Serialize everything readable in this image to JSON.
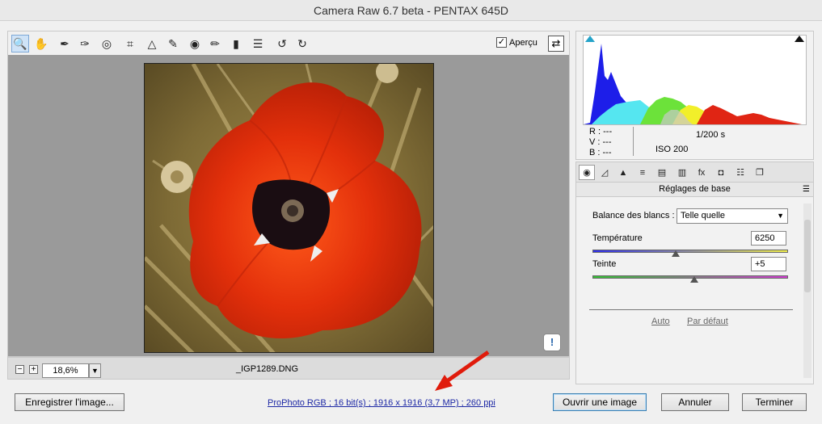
{
  "window": {
    "title": "Camera Raw 6.7 beta  -  PENTAX 645D"
  },
  "toolbar": {
    "tools": [
      {
        "name": "zoom-tool-icon",
        "glyph": "🔍"
      },
      {
        "name": "hand-tool-icon",
        "glyph": "✋"
      },
      {
        "name": "white-balance-tool-icon",
        "glyph": "✒"
      },
      {
        "name": "color-sampler-tool-icon",
        "glyph": "✑"
      },
      {
        "name": "target-adjustment-tool-icon",
        "glyph": "◎"
      },
      {
        "name": "crop-tool-icon",
        "glyph": "⌗"
      },
      {
        "name": "straighten-tool-icon",
        "glyph": "△"
      },
      {
        "name": "spot-removal-tool-icon",
        "glyph": "✎"
      },
      {
        "name": "red-eye-tool-icon",
        "glyph": "◉"
      },
      {
        "name": "adjustment-brush-icon",
        "glyph": "✏"
      },
      {
        "name": "graduated-filter-icon",
        "glyph": "▮"
      },
      {
        "name": "preferences-icon",
        "glyph": "☰"
      },
      {
        "name": "rotate-left-icon",
        "glyph": "↺"
      },
      {
        "name": "rotate-right-icon",
        "glyph": "↻"
      }
    ],
    "preview_label": "Aperçu",
    "preview_checked": "✓",
    "fullscreen_glyph": "⇄"
  },
  "status": {
    "zoom_value": "18,6%",
    "zoom_out": "−",
    "zoom_in": "+",
    "filename": "_IGP1289.DNG"
  },
  "info_panel": {
    "r_label": "R :  ---",
    "v_label": "V :  ---",
    "b_label": "B :  ---",
    "shutter": "1/200 s",
    "iso": "ISO 200"
  },
  "panel": {
    "title": "Réglages de base",
    "white_balance_label": "Balance des blancs :",
    "white_balance_value": "Telle quelle",
    "temperature_label": "Température",
    "temperature_value": "6250",
    "tint_label": "Teinte",
    "tint_value": "+5",
    "auto_link": "Auto",
    "default_link": "Par défaut",
    "tabs": [
      {
        "name": "tab-basic",
        "glyph": "◉"
      },
      {
        "name": "tab-tone-curve",
        "glyph": "◿"
      },
      {
        "name": "tab-detail",
        "glyph": "▲"
      },
      {
        "name": "tab-hsl",
        "glyph": "≡"
      },
      {
        "name": "tab-split-toning",
        "glyph": "▤"
      },
      {
        "name": "tab-lens-corrections",
        "glyph": "▥"
      },
      {
        "name": "tab-effects",
        "glyph": "fx"
      },
      {
        "name": "tab-camera-calibration",
        "glyph": "◘"
      },
      {
        "name": "tab-presets",
        "glyph": "☷"
      },
      {
        "name": "tab-snapshots",
        "glyph": "❐"
      }
    ]
  },
  "bottom": {
    "save_button": "Enregistrer l'image...",
    "workflow_link": "ProPhoto RGB ; 16 bit(s) ; 1916 x 1916 (3,7 MP) ; 260 ppi",
    "open_button": "Ouvrir une image",
    "cancel_button": "Annuler",
    "done_button": "Terminer"
  },
  "colors": {
    "accent": "#3c7fb1",
    "annotation_arrow": "#e01b0b"
  }
}
